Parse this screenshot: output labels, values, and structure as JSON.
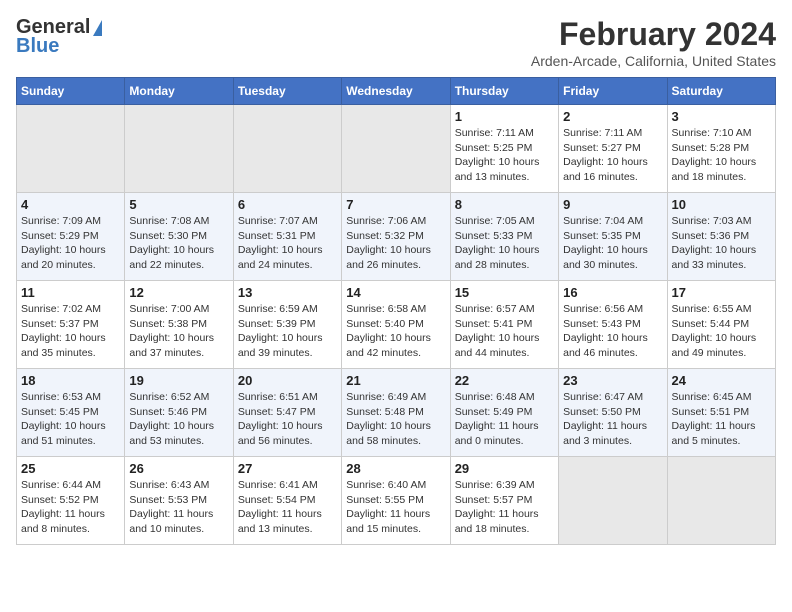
{
  "header": {
    "logo_general": "General",
    "logo_blue": "Blue",
    "main_title": "February 2024",
    "subtitle": "Arden-Arcade, California, United States"
  },
  "calendar": {
    "days_of_week": [
      "Sunday",
      "Monday",
      "Tuesday",
      "Wednesday",
      "Thursday",
      "Friday",
      "Saturday"
    ],
    "weeks": [
      [
        {
          "day": "",
          "info": ""
        },
        {
          "day": "",
          "info": ""
        },
        {
          "day": "",
          "info": ""
        },
        {
          "day": "",
          "info": ""
        },
        {
          "day": "1",
          "info": "Sunrise: 7:11 AM\nSunset: 5:25 PM\nDaylight: 10 hours\nand 13 minutes."
        },
        {
          "day": "2",
          "info": "Sunrise: 7:11 AM\nSunset: 5:27 PM\nDaylight: 10 hours\nand 16 minutes."
        },
        {
          "day": "3",
          "info": "Sunrise: 7:10 AM\nSunset: 5:28 PM\nDaylight: 10 hours\nand 18 minutes."
        }
      ],
      [
        {
          "day": "4",
          "info": "Sunrise: 7:09 AM\nSunset: 5:29 PM\nDaylight: 10 hours\nand 20 minutes."
        },
        {
          "day": "5",
          "info": "Sunrise: 7:08 AM\nSunset: 5:30 PM\nDaylight: 10 hours\nand 22 minutes."
        },
        {
          "day": "6",
          "info": "Sunrise: 7:07 AM\nSunset: 5:31 PM\nDaylight: 10 hours\nand 24 minutes."
        },
        {
          "day": "7",
          "info": "Sunrise: 7:06 AM\nSunset: 5:32 PM\nDaylight: 10 hours\nand 26 minutes."
        },
        {
          "day": "8",
          "info": "Sunrise: 7:05 AM\nSunset: 5:33 PM\nDaylight: 10 hours\nand 28 minutes."
        },
        {
          "day": "9",
          "info": "Sunrise: 7:04 AM\nSunset: 5:35 PM\nDaylight: 10 hours\nand 30 minutes."
        },
        {
          "day": "10",
          "info": "Sunrise: 7:03 AM\nSunset: 5:36 PM\nDaylight: 10 hours\nand 33 minutes."
        }
      ],
      [
        {
          "day": "11",
          "info": "Sunrise: 7:02 AM\nSunset: 5:37 PM\nDaylight: 10 hours\nand 35 minutes."
        },
        {
          "day": "12",
          "info": "Sunrise: 7:00 AM\nSunset: 5:38 PM\nDaylight: 10 hours\nand 37 minutes."
        },
        {
          "day": "13",
          "info": "Sunrise: 6:59 AM\nSunset: 5:39 PM\nDaylight: 10 hours\nand 39 minutes."
        },
        {
          "day": "14",
          "info": "Sunrise: 6:58 AM\nSunset: 5:40 PM\nDaylight: 10 hours\nand 42 minutes."
        },
        {
          "day": "15",
          "info": "Sunrise: 6:57 AM\nSunset: 5:41 PM\nDaylight: 10 hours\nand 44 minutes."
        },
        {
          "day": "16",
          "info": "Sunrise: 6:56 AM\nSunset: 5:43 PM\nDaylight: 10 hours\nand 46 minutes."
        },
        {
          "day": "17",
          "info": "Sunrise: 6:55 AM\nSunset: 5:44 PM\nDaylight: 10 hours\nand 49 minutes."
        }
      ],
      [
        {
          "day": "18",
          "info": "Sunrise: 6:53 AM\nSunset: 5:45 PM\nDaylight: 10 hours\nand 51 minutes."
        },
        {
          "day": "19",
          "info": "Sunrise: 6:52 AM\nSunset: 5:46 PM\nDaylight: 10 hours\nand 53 minutes."
        },
        {
          "day": "20",
          "info": "Sunrise: 6:51 AM\nSunset: 5:47 PM\nDaylight: 10 hours\nand 56 minutes."
        },
        {
          "day": "21",
          "info": "Sunrise: 6:49 AM\nSunset: 5:48 PM\nDaylight: 10 hours\nand 58 minutes."
        },
        {
          "day": "22",
          "info": "Sunrise: 6:48 AM\nSunset: 5:49 PM\nDaylight: 11 hours\nand 0 minutes."
        },
        {
          "day": "23",
          "info": "Sunrise: 6:47 AM\nSunset: 5:50 PM\nDaylight: 11 hours\nand 3 minutes."
        },
        {
          "day": "24",
          "info": "Sunrise: 6:45 AM\nSunset: 5:51 PM\nDaylight: 11 hours\nand 5 minutes."
        }
      ],
      [
        {
          "day": "25",
          "info": "Sunrise: 6:44 AM\nSunset: 5:52 PM\nDaylight: 11 hours\nand 8 minutes."
        },
        {
          "day": "26",
          "info": "Sunrise: 6:43 AM\nSunset: 5:53 PM\nDaylight: 11 hours\nand 10 minutes."
        },
        {
          "day": "27",
          "info": "Sunrise: 6:41 AM\nSunset: 5:54 PM\nDaylight: 11 hours\nand 13 minutes."
        },
        {
          "day": "28",
          "info": "Sunrise: 6:40 AM\nSunset: 5:55 PM\nDaylight: 11 hours\nand 15 minutes."
        },
        {
          "day": "29",
          "info": "Sunrise: 6:39 AM\nSunset: 5:57 PM\nDaylight: 11 hours\nand 18 minutes."
        },
        {
          "day": "",
          "info": ""
        },
        {
          "day": "",
          "info": ""
        }
      ]
    ]
  }
}
